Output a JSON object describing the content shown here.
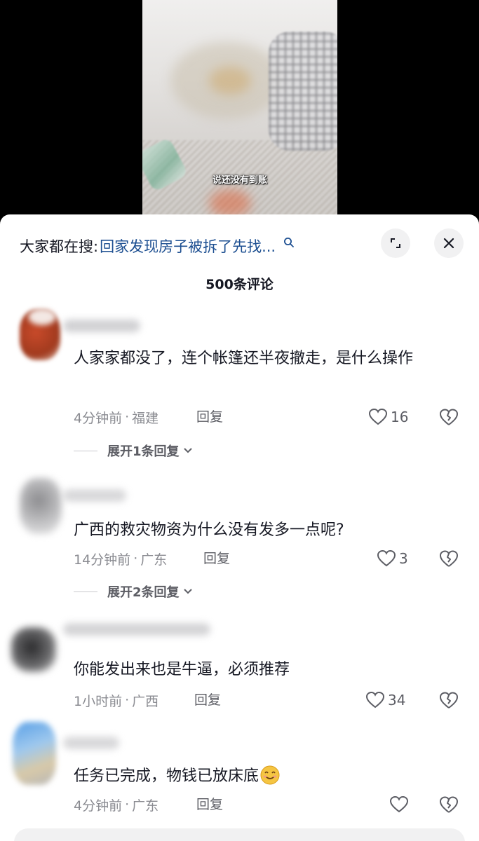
{
  "video": {
    "subtitle": "说还没有到账"
  },
  "search": {
    "prefix": "大家都在搜:",
    "query": "回家发现房子被拆了先找...",
    "icon": "search-icon"
  },
  "header": {
    "comment_count": "500条评论",
    "expand_icon": "expand-icon",
    "close_icon": "close-icon"
  },
  "comments": [
    {
      "text": "人家家都没了，连个帐篷还半夜撤走，是什么操作",
      "time": "4分钟前",
      "location": "福建",
      "reply_label": "回复",
      "likes": "16",
      "expand_label": "展开1条回复"
    },
    {
      "text": "广西的救灾物资为什么没有发多一点呢?",
      "time": "14分钟前",
      "location": "广东",
      "reply_label": "回复",
      "likes": "3",
      "expand_label": "展开2条回复"
    },
    {
      "text": "你能发出来也是牛逼，必须推荐",
      "time": "1小时前",
      "location": "广西",
      "reply_label": "回复",
      "likes": "34"
    },
    {
      "text": "任务已完成，物钱已放床底",
      "emoji": "smiling-emoji",
      "time": "4分钟前",
      "location": "广东",
      "reply_label": "回复",
      "likes": ""
    }
  ],
  "colors": {
    "link": "#1d4f91",
    "text": "#161823",
    "meta": "#8a8b91"
  }
}
